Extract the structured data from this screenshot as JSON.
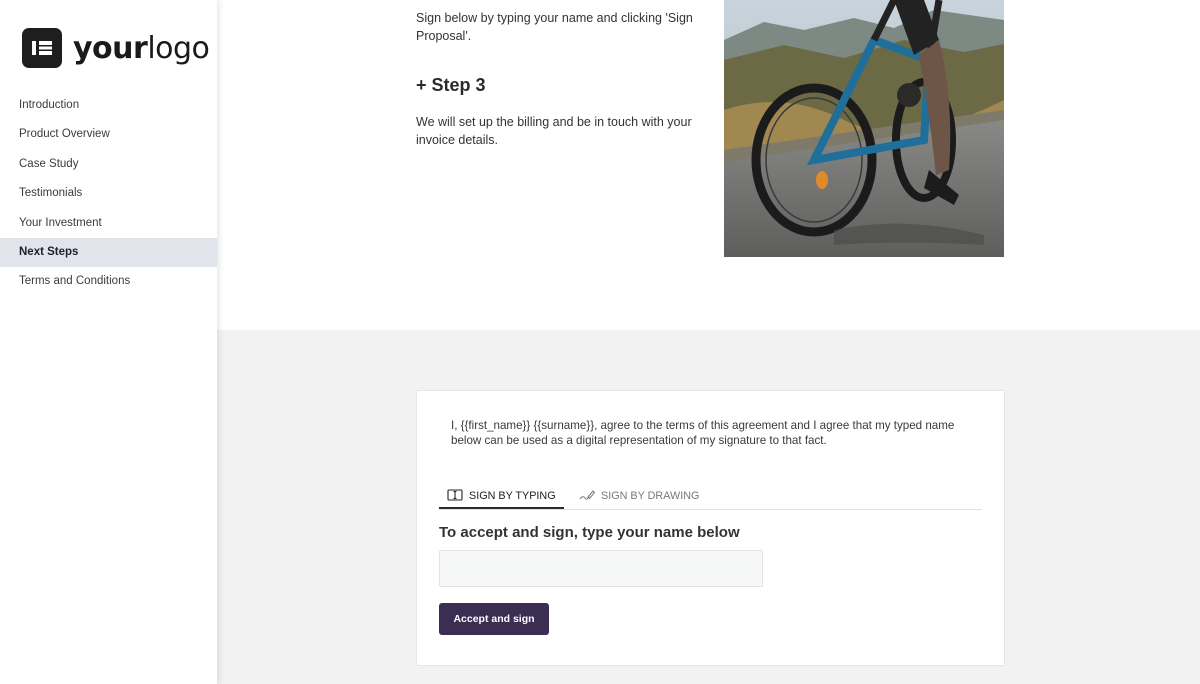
{
  "logo": {
    "bold": "your",
    "regular": "logo"
  },
  "sidebar": {
    "items": [
      {
        "label": "Introduction",
        "active": false
      },
      {
        "label": "Product Overview",
        "active": false
      },
      {
        "label": "Case Study",
        "active": false
      },
      {
        "label": "Testimonials",
        "active": false
      },
      {
        "label": "Your Investment",
        "active": false
      },
      {
        "label": "Next Steps",
        "active": true
      },
      {
        "label": "Terms and Conditions",
        "active": false
      }
    ]
  },
  "content": {
    "step2_text": "Sign below by typing your name and clicking 'Sign Proposal'.",
    "step3_heading": "+ Step 3",
    "step3_text": "We will set up the billing and be in touch with your invoice details."
  },
  "signature": {
    "agreement": "I, {{first_name}} {{surname}}, agree to the terms of this agreement and I agree that my typed name below can be used as a digital representation of my signature to that fact.",
    "tabs": [
      {
        "label": "SIGN BY TYPING",
        "icon": "keyboard-icon",
        "active": true
      },
      {
        "label": "SIGN BY DRAWING",
        "icon": "pen-icon",
        "active": false
      }
    ],
    "heading": "To accept and sign, type your name below",
    "input_value": "",
    "input_placeholder": "",
    "button_label": "Accept and sign"
  },
  "colors": {
    "accent": "#3b2e52",
    "active_nav_bg": "#e2e4ec",
    "panel_bg": "#f2f2f2"
  }
}
